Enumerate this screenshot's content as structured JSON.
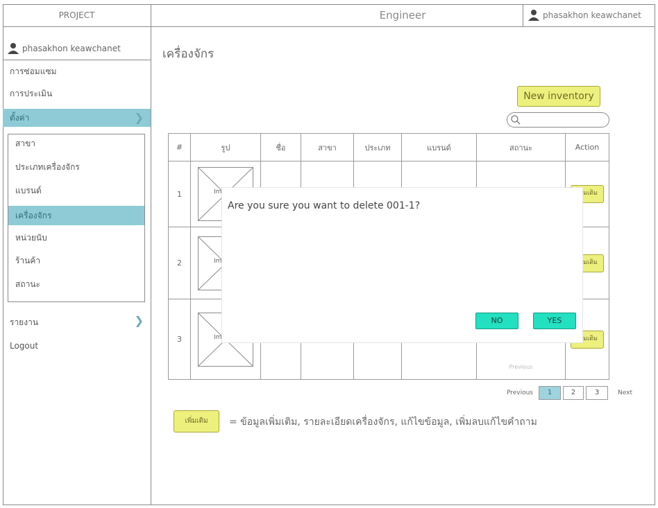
{
  "sidebar": {
    "header": "PROJECT",
    "user": "phasakhon keawchanet",
    "menu": [
      "การซ่อมแซม",
      "การประเมิน",
      "ตั้งค่า"
    ],
    "submenu": [
      "สาขา",
      "ประเภทเครื่องจักร",
      "แบรนด์",
      "เครื่องจักร",
      "หน่วยนับ",
      "ร้านค้า",
      "สถานะ"
    ],
    "report": "รายงาน",
    "logout": "Logout"
  },
  "header": {
    "title": "Engineer",
    "user": "phasakhon keawchanet"
  },
  "main": {
    "title": "เครื่องจักร",
    "new_button": "New inventory",
    "search_placeholder": "",
    "columns": [
      "#",
      "รูป",
      "ชื่อ",
      "สาขา",
      "ประเภท",
      "แบรนด์",
      "สถานะ",
      "Action"
    ],
    "rows": [
      {
        "num": "1",
        "img_label": "Im",
        "action": "เพิ่มเติม"
      },
      {
        "num": "2",
        "img_label": "Im",
        "action": "เพิ่มเติม"
      },
      {
        "num": "3",
        "img_label": "Im",
        "action": "เพิ่มเติม"
      }
    ],
    "inner_previous": "Previous",
    "pagination": {
      "previous": "Previous",
      "pages": [
        "1",
        "2",
        "3"
      ],
      "current": "1",
      "next": "Next"
    },
    "legend": {
      "button": "เพิ่มเติม",
      "text": "=  ข้อมูลเพิ่มเติม, รายละเอียดเครื่องจักร, แก้ไขข้อมูล, เพิ่มลบแก้ไขคำถาม"
    }
  },
  "modal": {
    "message": "Are you sure you want to delete 001-1?",
    "no_label": "NO",
    "yes_label": "YES"
  },
  "colors": {
    "active": "#8ecbd6",
    "yellow": "#eef07e",
    "modal_button": "#22e0c0"
  },
  "icons": [
    "user-icon",
    "chevron-right-icon",
    "search-icon",
    "image-placeholder-icon"
  ]
}
